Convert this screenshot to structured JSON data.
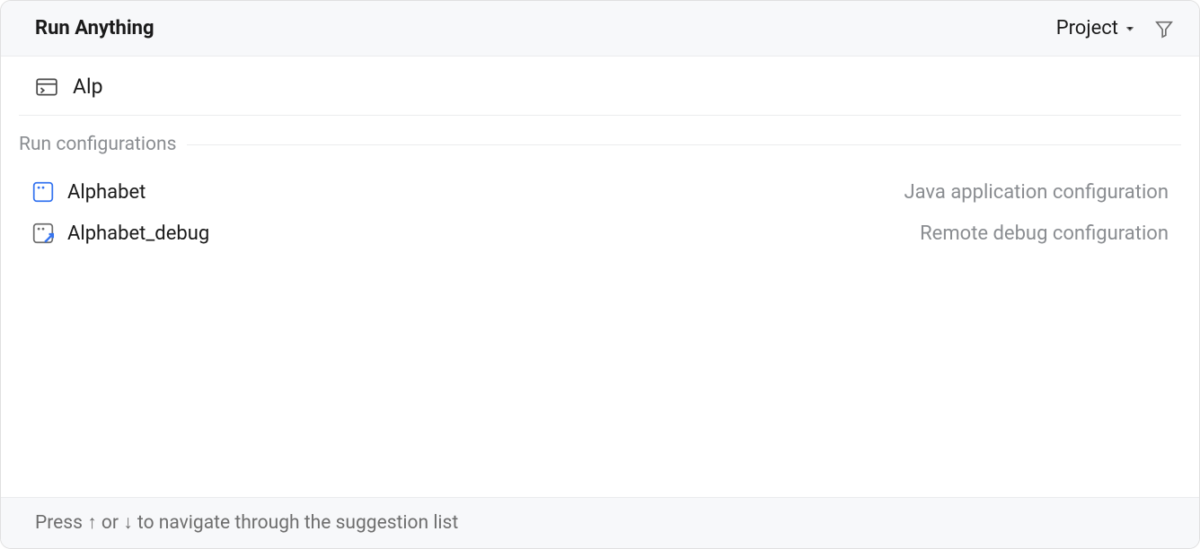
{
  "header": {
    "title": "Run Anything",
    "scope": "Project"
  },
  "input": {
    "value": "Alp"
  },
  "section": {
    "label": "Run configurations"
  },
  "results": [
    {
      "name": "Alphabet",
      "description": "Java application configuration",
      "icon": "app-config"
    },
    {
      "name": "Alphabet_debug",
      "description": "Remote debug configuration",
      "icon": "debug-config"
    }
  ],
  "footer": {
    "hint": "Press ↑ or ↓ to navigate through the suggestion list"
  }
}
